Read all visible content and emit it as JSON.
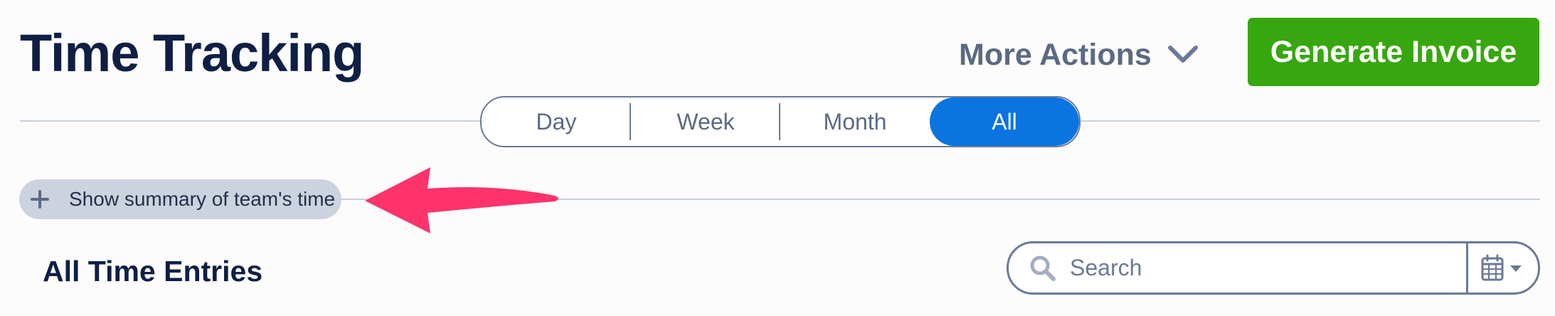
{
  "header": {
    "title": "Time Tracking",
    "more_actions_label": "More Actions",
    "generate_invoice_label": "Generate Invoice"
  },
  "period_toggle": {
    "options": [
      "Day",
      "Week",
      "Month",
      "All"
    ],
    "selected": "All"
  },
  "summary_toggle": {
    "label": "Show summary of team's time"
  },
  "entries": {
    "title": "All Time Entries",
    "search": {
      "placeholder": "Search",
      "value": ""
    }
  },
  "colors": {
    "primary_text": "#0f1f44",
    "muted_text": "#5b6a82",
    "invoice_button": "#37a70f",
    "selected_toggle": "#0a74e0",
    "summary_pill": "#ccd3de",
    "annotation_arrow": "#ff336b"
  },
  "icons": {
    "more_actions": "chevron-down-icon",
    "summary": "plus-icon",
    "search": "search-icon",
    "date_picker": "calendar-icon",
    "date_picker_dropdown": "caret-down-icon",
    "annotation": "arrow-annotation"
  }
}
